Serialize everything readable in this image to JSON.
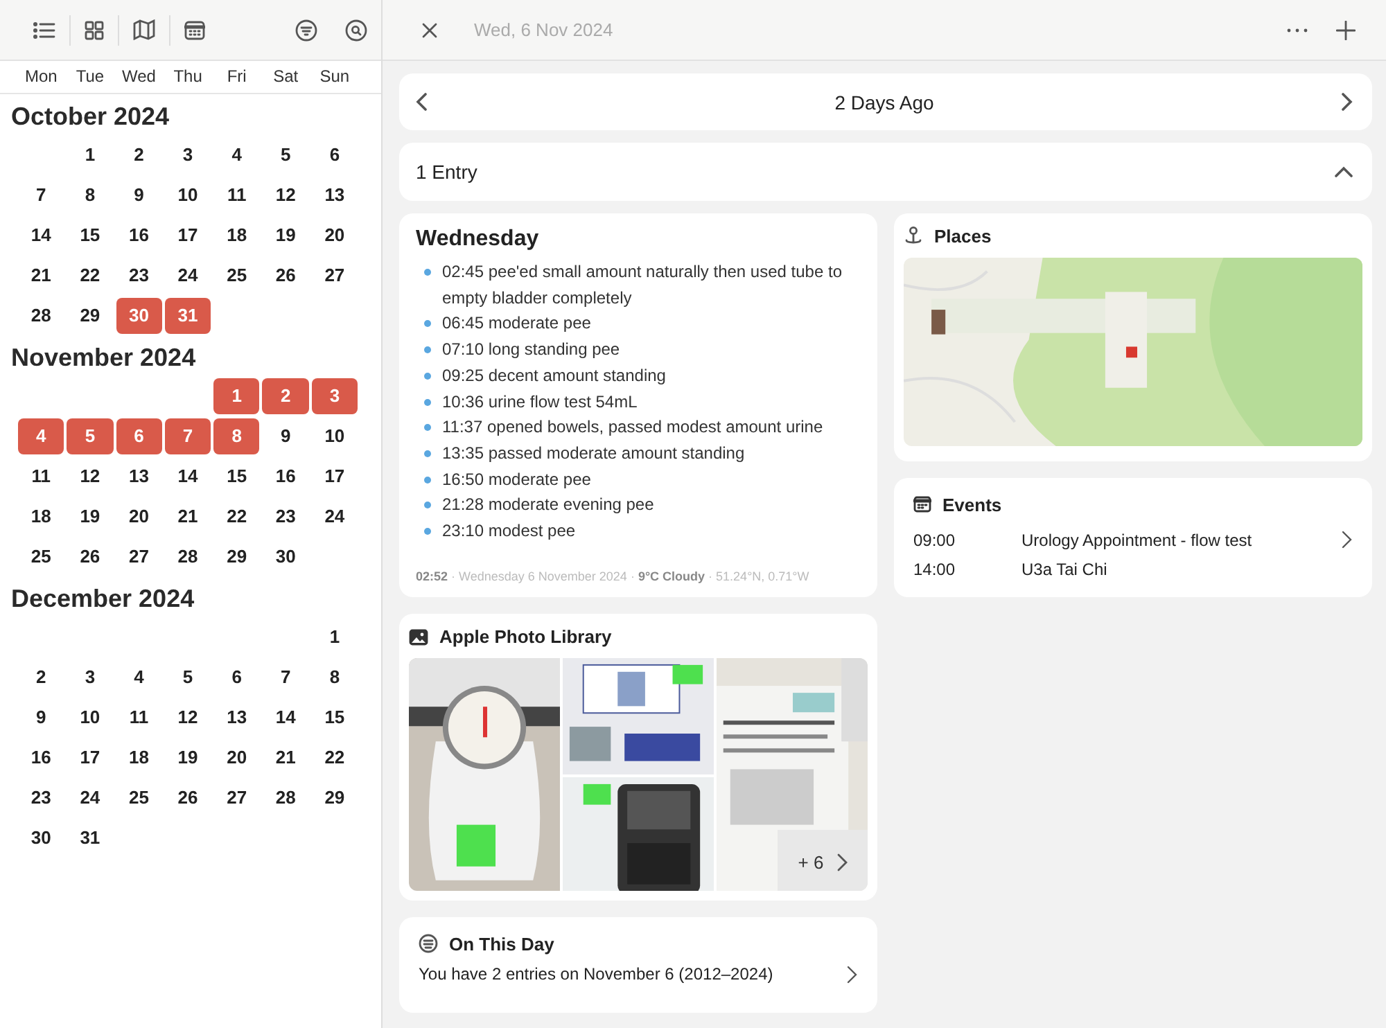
{
  "header": {
    "date": "Wed, 6 Nov 2024"
  },
  "weekdays": [
    "Mon",
    "Tue",
    "Wed",
    "Thu",
    "Fri",
    "Sat",
    "Sun"
  ],
  "months": [
    {
      "title": "October 2024",
      "weeks": [
        [
          {
            "day": "1",
            "marked": false
          },
          {
            "day": "2",
            "marked": false
          },
          {
            "day": "3",
            "marked": false
          },
          {
            "day": "4",
            "marked": false
          },
          {
            "day": "5",
            "marked": false
          },
          {
            "day": "6",
            "marked": false
          }
        ],
        [
          {
            "day": "7",
            "marked": false
          },
          {
            "day": "8",
            "marked": false
          },
          {
            "day": "9",
            "marked": false
          },
          {
            "day": "10",
            "marked": false
          },
          {
            "day": "11",
            "marked": false
          },
          {
            "day": "12",
            "marked": false
          },
          {
            "day": "13",
            "marked": false
          }
        ],
        [
          {
            "day": "14",
            "marked": false
          },
          {
            "day": "15",
            "marked": false
          },
          {
            "day": "16",
            "marked": false
          },
          {
            "day": "17",
            "marked": false
          },
          {
            "day": "18",
            "marked": false
          },
          {
            "day": "19",
            "marked": false
          },
          {
            "day": "20",
            "marked": false
          }
        ],
        [
          {
            "day": "21",
            "marked": false
          },
          {
            "day": "22",
            "marked": false
          },
          {
            "day": "23",
            "marked": false
          },
          {
            "day": "24",
            "marked": false
          },
          {
            "day": "25",
            "marked": false
          },
          {
            "day": "26",
            "marked": false
          },
          {
            "day": "27",
            "marked": false
          }
        ],
        [
          {
            "day": "28",
            "marked": false
          },
          {
            "day": "29",
            "marked": false
          },
          {
            "day": "30",
            "marked": true
          },
          {
            "day": "31",
            "marked": true
          }
        ]
      ]
    },
    {
      "title": "November 2024",
      "weeks": [
        [
          {
            "day": "1",
            "marked": true
          },
          {
            "day": "2",
            "marked": true
          },
          {
            "day": "3",
            "marked": true
          }
        ],
        [
          {
            "day": "4",
            "marked": true
          },
          {
            "day": "5",
            "marked": true
          },
          {
            "day": "6",
            "marked": true
          },
          {
            "day": "7",
            "marked": true
          },
          {
            "day": "8",
            "marked": true
          },
          {
            "day": "9",
            "marked": false
          },
          {
            "day": "10",
            "marked": false
          }
        ],
        [
          {
            "day": "11",
            "marked": false
          },
          {
            "day": "12",
            "marked": false
          },
          {
            "day": "13",
            "marked": false
          },
          {
            "day": "14",
            "marked": false
          },
          {
            "day": "15",
            "marked": false
          },
          {
            "day": "16",
            "marked": false
          },
          {
            "day": "17",
            "marked": false
          }
        ],
        [
          {
            "day": "18",
            "marked": false
          },
          {
            "day": "19",
            "marked": false
          },
          {
            "day": "20",
            "marked": false
          },
          {
            "day": "21",
            "marked": false
          },
          {
            "day": "22",
            "marked": false
          },
          {
            "day": "23",
            "marked": false
          },
          {
            "day": "24",
            "marked": false
          }
        ],
        [
          {
            "day": "25",
            "marked": false
          },
          {
            "day": "26",
            "marked": false
          },
          {
            "day": "27",
            "marked": false
          },
          {
            "day": "28",
            "marked": false
          },
          {
            "day": "29",
            "marked": false
          },
          {
            "day": "30",
            "marked": false
          }
        ]
      ]
    },
    {
      "title": "December 2024",
      "weeks": [
        [
          {
            "day": "1",
            "marked": false
          }
        ],
        [
          {
            "day": "2",
            "marked": false
          },
          {
            "day": "3",
            "marked": false
          },
          {
            "day": "4",
            "marked": false
          },
          {
            "day": "5",
            "marked": false
          },
          {
            "day": "6",
            "marked": false
          },
          {
            "day": "7",
            "marked": false
          },
          {
            "day": "8",
            "marked": false
          }
        ],
        [
          {
            "day": "9",
            "marked": false
          },
          {
            "day": "10",
            "marked": false
          },
          {
            "day": "11",
            "marked": false
          },
          {
            "day": "12",
            "marked": false
          },
          {
            "day": "13",
            "marked": false
          },
          {
            "day": "14",
            "marked": false
          },
          {
            "day": "15",
            "marked": false
          }
        ],
        [
          {
            "day": "16",
            "marked": false
          },
          {
            "day": "17",
            "marked": false
          },
          {
            "day": "18",
            "marked": false
          },
          {
            "day": "19",
            "marked": false
          },
          {
            "day": "20",
            "marked": false
          },
          {
            "day": "21",
            "marked": false
          },
          {
            "day": "22",
            "marked": false
          }
        ],
        [
          {
            "day": "23",
            "marked": false
          },
          {
            "day": "24",
            "marked": false
          },
          {
            "day": "25",
            "marked": false
          },
          {
            "day": "26",
            "marked": false
          },
          {
            "day": "27",
            "marked": false
          },
          {
            "day": "28",
            "marked": false
          },
          {
            "day": "29",
            "marked": false
          }
        ],
        [
          {
            "day": "30",
            "marked": false
          },
          {
            "day": "31",
            "marked": false
          }
        ]
      ]
    }
  ],
  "day_nav": {
    "title": "2 Days Ago"
  },
  "entries_bar": {
    "label": "1 Entry",
    "expanded": true
  },
  "journal": {
    "heading": "Wednesday",
    "items": [
      "02:45 pee'ed small amount naturally then used tube to empty bladder completely",
      "06:45 moderate pee",
      "07:10 long standing pee",
      "09:25 decent amount standing",
      "10:36 urine flow test 54mL",
      "11:37 opened bowels, passed modest amount urine",
      "13:35 passed moderate amount standing",
      "16:50 moderate pee",
      "21:28 moderate evening pee",
      "23:10 modest pee"
    ],
    "meta": "**02:52** · Wednesday 6 November 2024 · **9°C Cloudy** · 51.24°N, 0.71°W"
  },
  "photos": {
    "title": "Apple Photo Library",
    "more": "+ 6"
  },
  "places": {
    "title": "Places"
  },
  "on_this_day": {
    "title": "On This Day",
    "text": "You have 2 entries on November 6 (2012–2024)"
  },
  "events": {
    "title": "Events",
    "items": [
      {
        "time": "09:00",
        "name": "Urology Appointment - flow test"
      },
      {
        "time": "14:00",
        "name": "U3a Tai Chi"
      }
    ]
  }
}
